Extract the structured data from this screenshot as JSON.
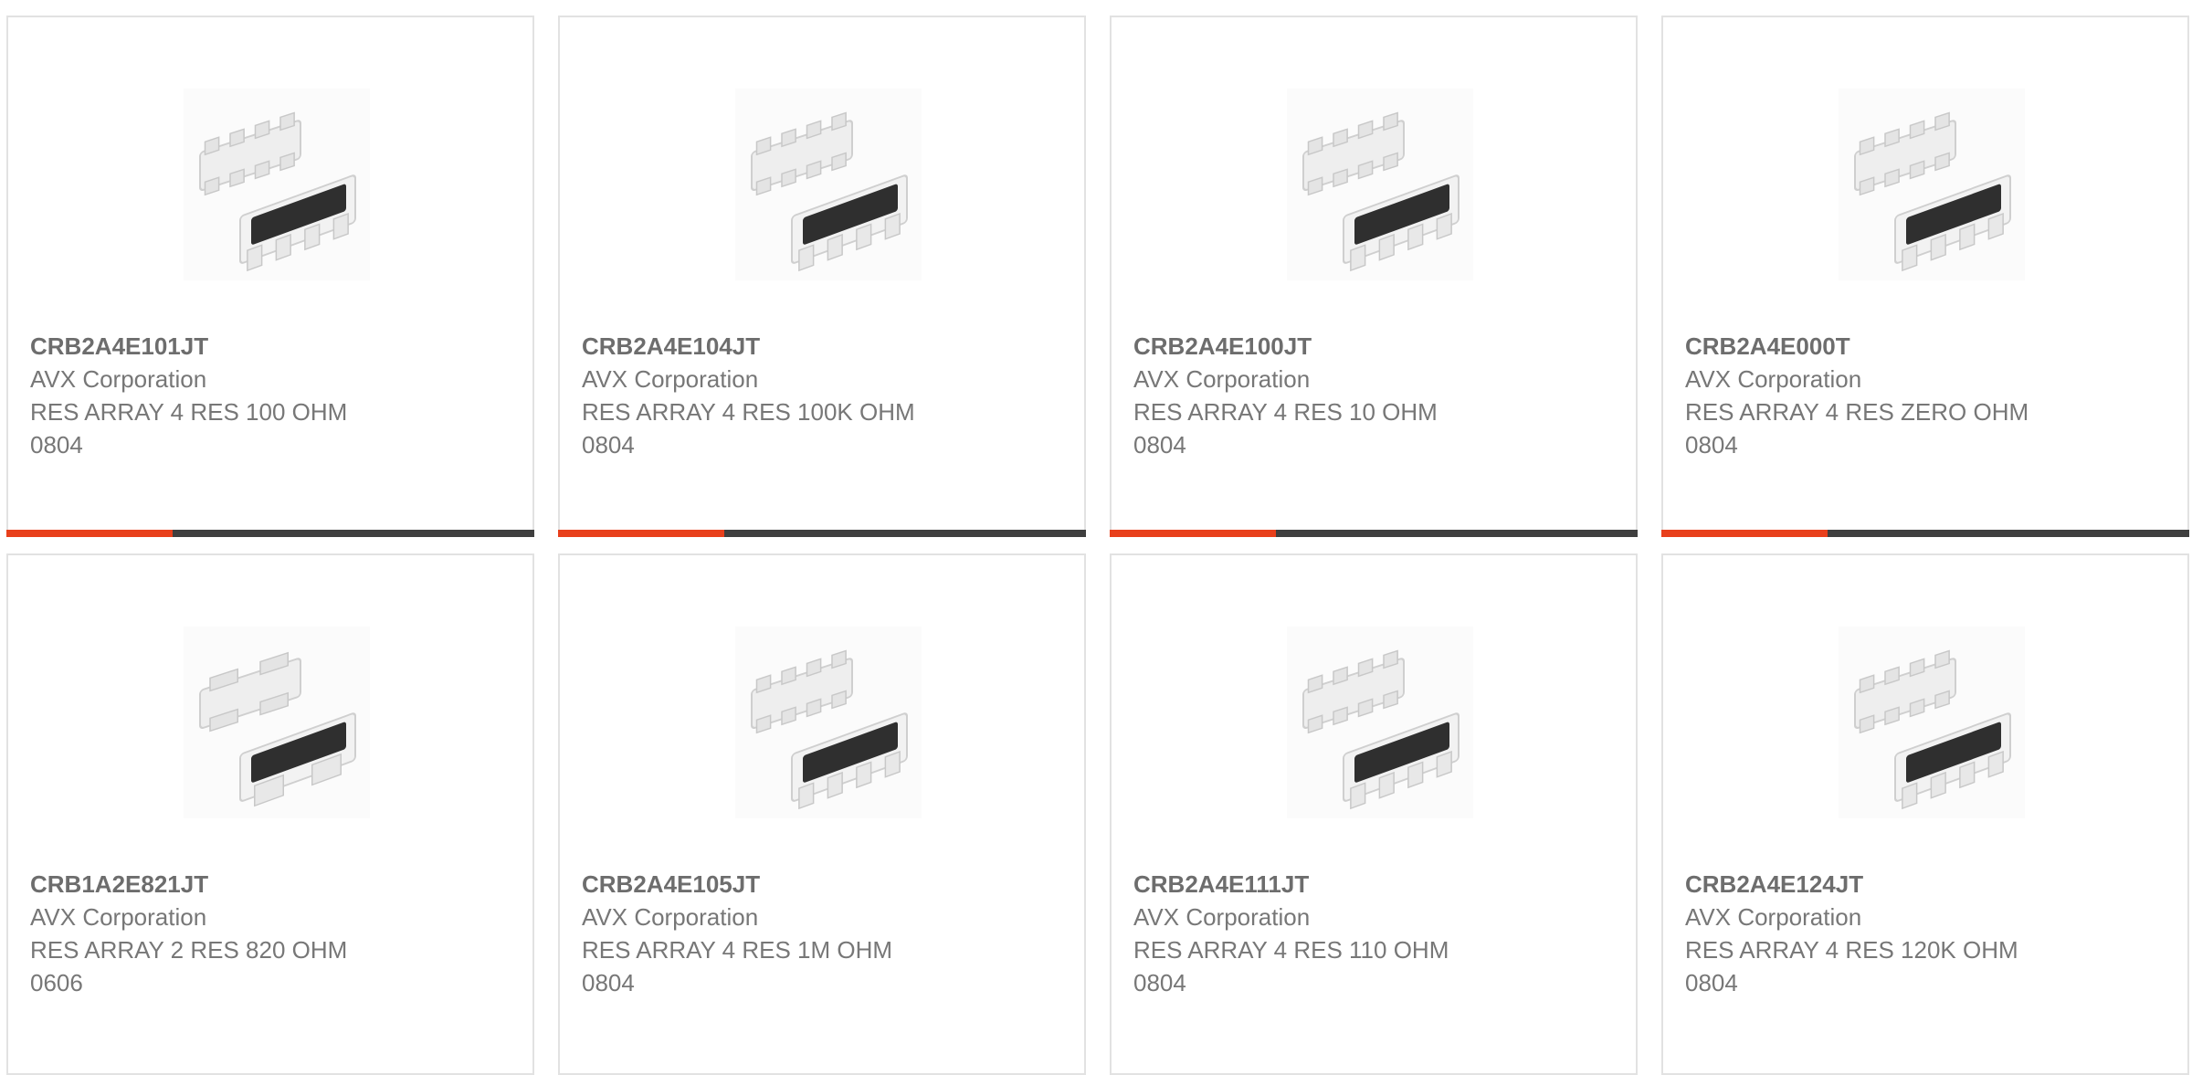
{
  "products": [
    {
      "part": "CRB2A4E101JT",
      "maker": "AVX Corporation",
      "desc": "RES ARRAY 4 RES 100 OHM",
      "size": "0804",
      "array": 4
    },
    {
      "part": "CRB2A4E104JT",
      "maker": "AVX Corporation",
      "desc": "RES ARRAY 4 RES 100K OHM",
      "size": "0804",
      "array": 4
    },
    {
      "part": "CRB2A4E100JT",
      "maker": "AVX Corporation",
      "desc": "RES ARRAY 4 RES 10 OHM",
      "size": "0804",
      "array": 4
    },
    {
      "part": "CRB2A4E000T",
      "maker": "AVX Corporation",
      "desc": "RES ARRAY 4 RES ZERO OHM",
      "size": "0804",
      "array": 4
    },
    {
      "part": "CRB1A2E821JT",
      "maker": "AVX Corporation",
      "desc": "RES ARRAY 2 RES 820 OHM",
      "size": "0606",
      "array": 2
    },
    {
      "part": "CRB2A4E105JT",
      "maker": "AVX Corporation",
      "desc": "RES ARRAY 4 RES 1M OHM",
      "size": "0804",
      "array": 4
    },
    {
      "part": "CRB2A4E111JT",
      "maker": "AVX Corporation",
      "desc": "RES ARRAY 4 RES 110 OHM",
      "size": "0804",
      "array": 4
    },
    {
      "part": "CRB2A4E124JT",
      "maker": "AVX Corporation",
      "desc": "RES ARRAY 4 RES 120K OHM",
      "size": "0804",
      "array": 4
    }
  ],
  "colors": {
    "accent": "#e8401c",
    "bar": "#3f3f3f",
    "border": "#e2e2e2",
    "text": "#777777"
  },
  "icons": {
    "product_image": "resistor-array-chip-icon"
  }
}
